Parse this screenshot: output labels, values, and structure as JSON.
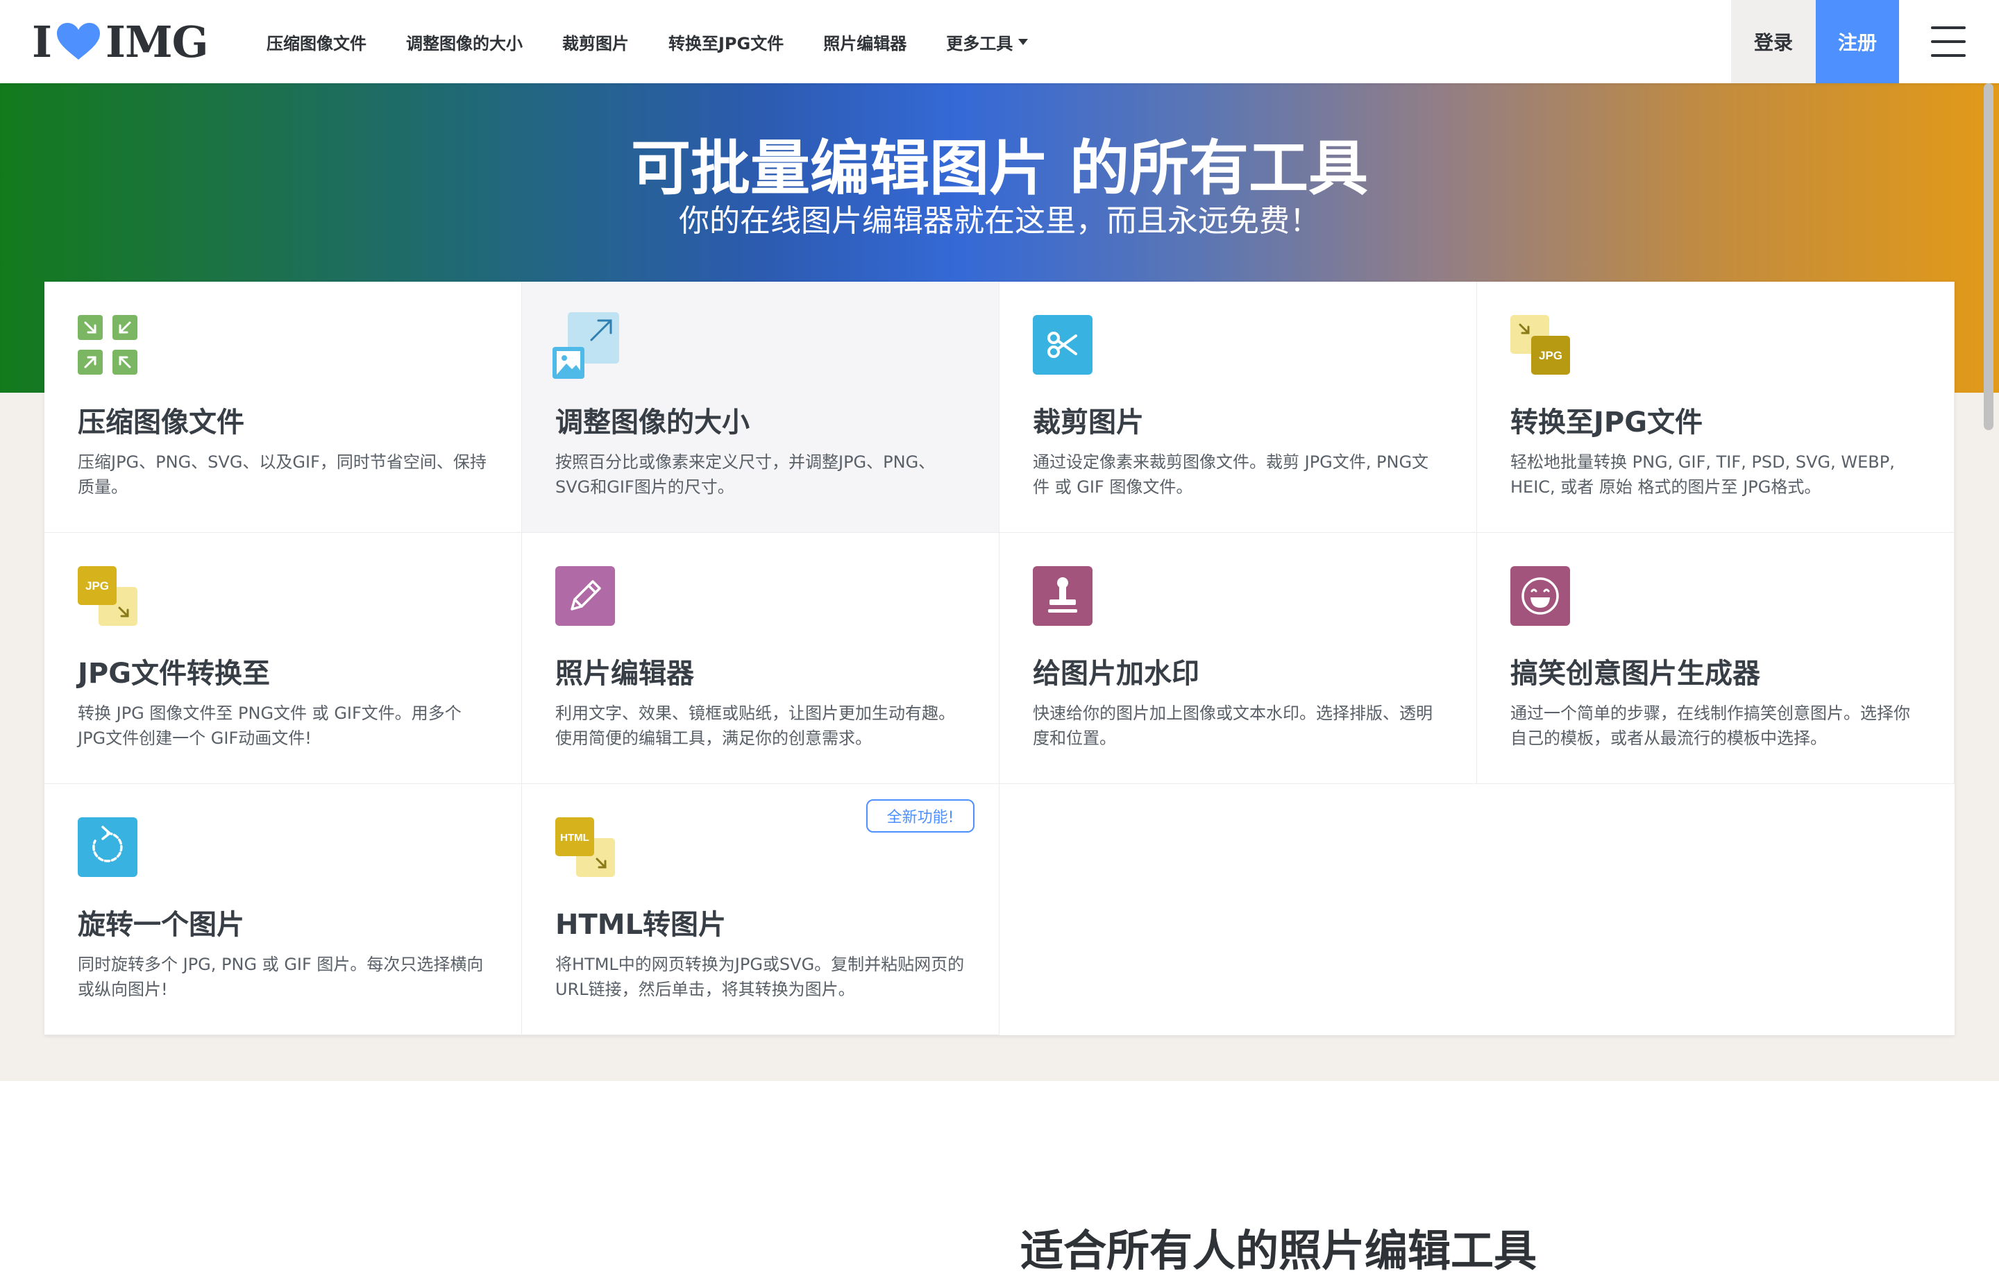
{
  "header": {
    "logo_left": "I",
    "logo_right": "IMG",
    "nav": [
      {
        "label": "压缩图像文件"
      },
      {
        "label": "调整图像的大小"
      },
      {
        "label": "裁剪图片"
      },
      {
        "label": "转换至JPG文件"
      },
      {
        "label": "照片编辑器"
      },
      {
        "label": "更多工具"
      }
    ],
    "login": "登录",
    "signup": "注册"
  },
  "hero": {
    "title": "可批量编辑图片 的所有工具",
    "subtitle": "你的在线图片编辑器就在这里，而且永远免费！"
  },
  "tools": [
    {
      "title": "压缩图像文件",
      "desc": "压缩JPG、PNG、SVG、以及GIF，同时节省空间、保持质量。",
      "icon": "compress-icon"
    },
    {
      "title": "调整图像的大小",
      "desc": "按照百分比或像素来定义尺寸，并调整JPG、PNG、SVG和GIF图片的尺寸。",
      "icon": "resize-icon"
    },
    {
      "title": "裁剪图片",
      "desc": "通过设定像素来裁剪图像文件。裁剪 JPG文件, PNG文件 或 GIF 图像文件。",
      "icon": "scissors-icon"
    },
    {
      "title": "转换至JPG文件",
      "desc": "轻松地批量转换 PNG, GIF, TIF, PSD, SVG, WEBP, HEIC, 或者 原始 格式的图片至 JPG格式。",
      "icon": "convert-to-jpg-icon",
      "icon_label": "JPG"
    },
    {
      "title": "JPG文件转换至",
      "desc": "转换 JPG 图像文件至 PNG文件 或 GIF文件。用多个JPG文件创建一个 GIF动画文件!",
      "icon": "convert-from-jpg-icon",
      "icon_label": "JPG"
    },
    {
      "title": "照片编辑器",
      "desc": "利用文字、效果、镜框或贴纸，让图片更加生动有趣。使用简便的编辑工具，满足你的创意需求。",
      "icon": "pencil-icon"
    },
    {
      "title": "给图片加水印",
      "desc": "快速给你的图片加上图像或文本水印。选择排版、透明度和位置。",
      "icon": "stamp-icon"
    },
    {
      "title": "搞笑创意图片生成器",
      "desc": "通过一个简单的步骤，在线制作搞笑创意图片。选择你自己的模板，或者从最流行的模板中选择。",
      "icon": "meme-smile-icon"
    },
    {
      "title": "旋转一个图片",
      "desc": "同时旋转多个 JPG, PNG 或 GIF 图片。每次只选择横向或纵向图片!",
      "icon": "rotate-icon"
    },
    {
      "title": "HTML转图片",
      "desc": "将HTML中的网页转换为JPG或SVG。复制并粘贴网页的URL链接，然后单击，将其转换为图片。",
      "icon": "html-to-image-icon",
      "icon_label": "HTML",
      "badge": "全新功能!"
    }
  ],
  "bottom_heading": "适合所有人的照片编辑工具",
  "colors": {
    "accent_blue": "#4d90fe",
    "compress_green": "#7bb662",
    "resize_blue": "#4fb9e8",
    "crop_blue": "#38b2e0",
    "jpg_yellow": "#d6b21c",
    "editor_purple": "#b06aa6",
    "watermark_purple": "#a2547d",
    "meme_purple": "#a2547d",
    "rotate_blue": "#38b2e0"
  }
}
